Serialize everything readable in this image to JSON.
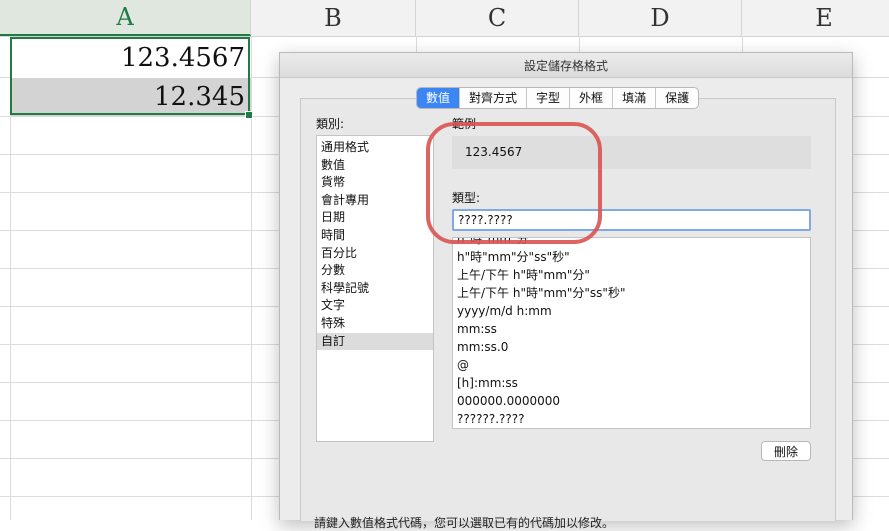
{
  "spreadsheet": {
    "columns": [
      "A",
      "B",
      "C",
      "D",
      "E"
    ],
    "cells": {
      "a1": "123.4567",
      "a2": "12.345"
    }
  },
  "dialog": {
    "title": "設定儲存格格式",
    "tabs": [
      "數值",
      "對齊方式",
      "字型",
      "外框",
      "填滿",
      "保護"
    ],
    "active_tab": "數值",
    "category_label": "類別:",
    "categories": [
      "通用格式",
      "數值",
      "貨幣",
      "會計專用",
      "日期",
      "時間",
      "百分比",
      "分數",
      "科學記號",
      "文字",
      "特殊",
      "自訂"
    ],
    "selected_category": "自訂",
    "sample_label": "範例",
    "sample_value": "123.4567",
    "type_label": "類型:",
    "type_value": "????.????",
    "format_list": [
      "h\"時\"mm\"分\"",
      "h\"時\"mm\"分\"ss\"秒\"",
      "上午/下午 h\"時\"mm\"分\"",
      "上午/下午 h\"時\"mm\"分\"ss\"秒\"",
      "yyyy/m/d h:mm",
      "mm:ss",
      "mm:ss.0",
      "@",
      "[h]:mm:ss",
      "000000.0000000",
      "??????.????"
    ],
    "delete_label": "刪除",
    "hint_text": "請鍵入數值格式代碼，您可以選取已有的代碼加以修改。"
  },
  "colors": {
    "accent": "#3b86f2",
    "selection_green": "#1f7a44",
    "annotation_red": "#d9534f"
  }
}
